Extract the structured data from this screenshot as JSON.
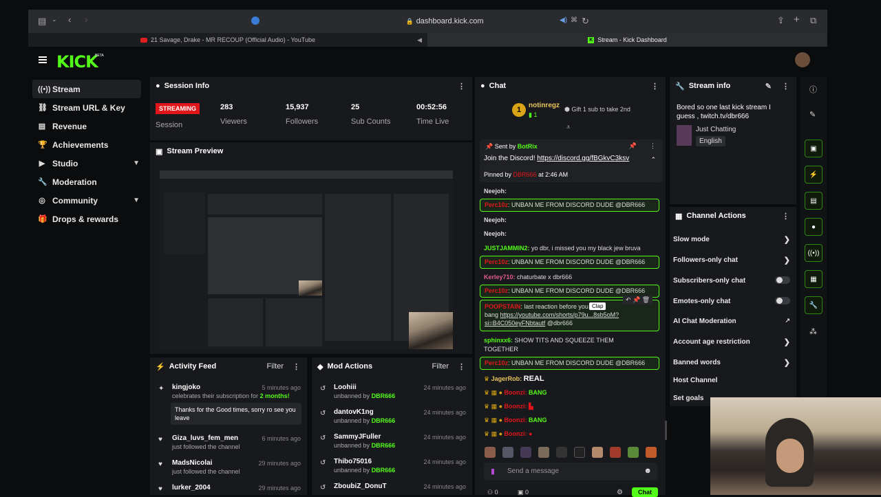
{
  "browser": {
    "url": "dashboard.kick.com",
    "tabs": [
      {
        "label": "21 Savage, Drake - MR RECOUP (Official Audio) - YouTube"
      },
      {
        "label": "Stream - Kick Dashboard"
      }
    ]
  },
  "brand": {
    "logo": "KICK",
    "beta": "BETA"
  },
  "sidebar": {
    "items": [
      {
        "label": "Stream",
        "icon": "broadcast-icon"
      },
      {
        "label": "Stream URL & Key",
        "icon": "link-icon"
      },
      {
        "label": "Revenue",
        "icon": "chart-icon"
      },
      {
        "label": "Achievements",
        "icon": "trophy-icon"
      },
      {
        "label": "Studio",
        "icon": "studio-icon"
      },
      {
        "label": "Moderation",
        "icon": "wrench-icon"
      },
      {
        "label": "Community",
        "icon": "globe-icon"
      },
      {
        "label": "Drops & rewards",
        "icon": "gift-icon"
      }
    ]
  },
  "session": {
    "title": "Session Info",
    "status": "STREAMING",
    "status_label": "Session",
    "viewers": "283",
    "viewers_label": "Viewers",
    "followers": "15,937",
    "followers_label": "Followers",
    "subs": "25",
    "subs_label": "Sub Counts",
    "time": "00:52:56",
    "time_label": "Time Live"
  },
  "preview": {
    "title": "Stream Preview"
  },
  "activity": {
    "title": "Activity Feed",
    "filter": "Filter",
    "items": [
      {
        "name": "kingjoko",
        "sub": "celebrates their subscription for",
        "months": "2 months!",
        "time": "5 minutes ago",
        "message": "Thanks for the Good times, sorry ro see you leave"
      },
      {
        "name": "Giza_luvs_fem_men",
        "sub": "just followed the channel",
        "time": "6 minutes ago"
      },
      {
        "name": "MadsNicolai",
        "sub": "just followed the channel",
        "time": "29 minutes ago"
      },
      {
        "name": "lurker_2004",
        "time": "29 minutes ago"
      }
    ]
  },
  "mod": {
    "title": "Mod Actions",
    "filter": "Filter",
    "items": [
      {
        "name": "Loohiii",
        "action": "unbanned by",
        "by": "DBR666",
        "time": "24 minutes ago"
      },
      {
        "name": "dantovK1ng",
        "action": "unbanned by",
        "by": "DBR666",
        "time": "24 minutes ago"
      },
      {
        "name": "SammyJFuller",
        "action": "unbanned by",
        "by": "DBR666",
        "time": "24 minutes ago"
      },
      {
        "name": "Thibo75016",
        "action": "unbanned by",
        "by": "DBR666",
        "time": "24 minutes ago"
      },
      {
        "name": "ZboubiZ_DonuT",
        "time": "24 minutes ago"
      }
    ]
  },
  "chat": {
    "title": "Chat",
    "top_gifter": "notinregz",
    "top_gifter_count": "1",
    "gift_text": "Gift 1 sub to take 2nd",
    "pinned": {
      "sent_by": "Sent by",
      "bot": "BotRix",
      "text": "Join the Discord!",
      "link": "https://discord.gg/fBGkvC3ksv",
      "pinned_by": "Pinned by",
      "pinner": "DBR666",
      "at": "at 2:46 AM"
    },
    "messages": [
      {
        "user": "Neejoh:",
        "text": ""
      },
      {
        "user": "Perc10z",
        "text": ": UNBAN ME FROM DISCORD DUDE @DBR666"
      },
      {
        "user": "Neejoh:",
        "text": ""
      },
      {
        "user": "Neejoh:",
        "text": ""
      },
      {
        "user": "JUSTJAMMIN2:",
        "text": " yo dbr, i missed you my black jew bruva"
      },
      {
        "user": "Perc10z",
        "text": ": UNBAN ME FROM DISCORD DUDE @DBR666"
      },
      {
        "user": "Kerley710:",
        "text": " chaturbate x dbr666"
      },
      {
        "user": "Perc10z",
        "text": ": UNBAN ME FROM DISCORD DUDE @DBR666"
      },
      {
        "user": "POOPSTAIN",
        "text": ": last reaction before you",
        "text2": "bang",
        "link": "https://youtube.com/shorts/p79u...8sb5oM?si=B4C050eyFNbtautf",
        "mention": "@dbr666",
        "tooltip": "Clap"
      },
      {
        "user": "sphinxx6:",
        "text": " SHOW TITS AND SQUEEZE THEM TOGETHER"
      },
      {
        "user": "Perc10z",
        "text": ": UNBAN ME FROM DISCORD DUDE @DBR666"
      },
      {
        "user": "JagerRob:",
        "text": "REAL"
      },
      {
        "user": "Boonzi:",
        "text": "BANG"
      },
      {
        "user": "Boonzi:",
        "text": ""
      },
      {
        "user": "Boonzi:",
        "text": "BANG"
      },
      {
        "user": "Boonzi:",
        "text": ""
      }
    ],
    "input_placeholder": "Send a message",
    "chat_button": "Chat",
    "counts": [
      "0",
      "0"
    ]
  },
  "stream_info": {
    "title": "Stream info",
    "description": "Bored so one last kick stream I guess , twitch.tv/dbr666",
    "category": "Just Chatting",
    "language": "English"
  },
  "channel_actions": {
    "title": "Channel Actions",
    "items": [
      {
        "label": "Slow mode",
        "control": "arrow"
      },
      {
        "label": "Followers-only chat",
        "control": "arrow"
      },
      {
        "label": "Subscribers-only chat",
        "control": "toggle"
      },
      {
        "label": "Emotes-only chat",
        "control": "toggle"
      },
      {
        "label": "AI Chat Moderation",
        "control": "external"
      },
      {
        "label": "Account age restriction",
        "control": "arrow"
      },
      {
        "label": "Banned words",
        "control": "arrow"
      },
      {
        "label": "Host Channel",
        "control": "none"
      },
      {
        "label": "Set goals",
        "control": "arrow"
      }
    ]
  },
  "colors": {
    "accent": "#53fc18",
    "danger": "#e0161a",
    "panel": "#18191c",
    "bg": "#0b0c0e"
  }
}
